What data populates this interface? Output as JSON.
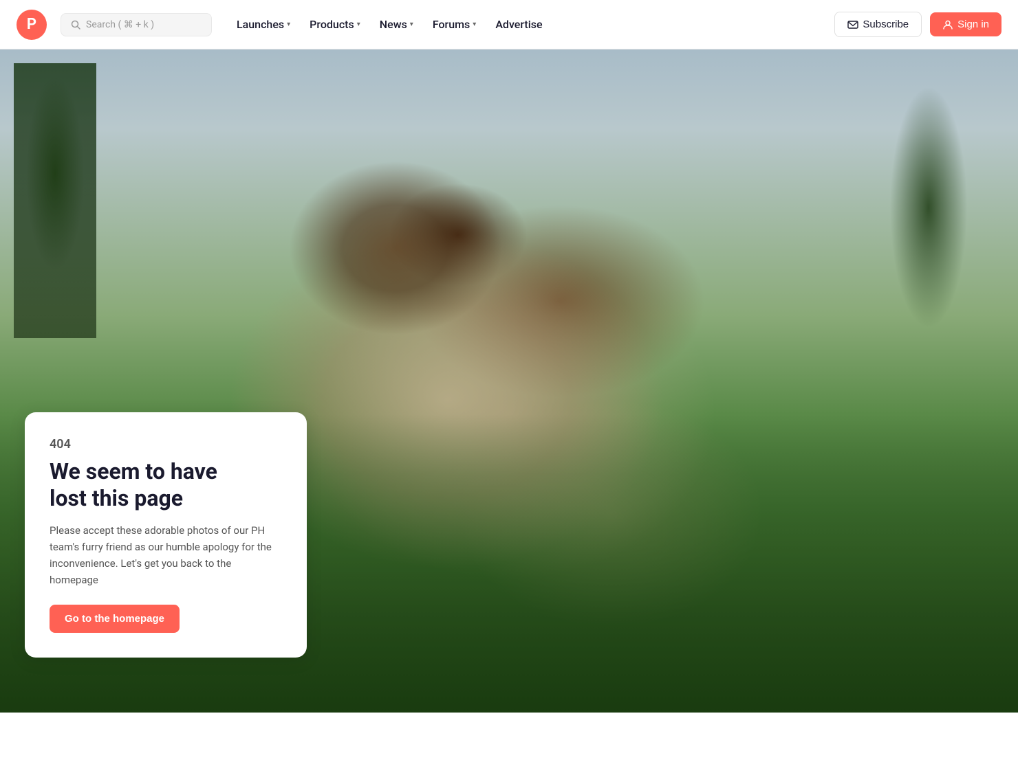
{
  "brand": {
    "logo_letter": "P",
    "logo_color": "#ff6154"
  },
  "search": {
    "placeholder": "Search ( ⌘ + k )"
  },
  "nav": {
    "items": [
      {
        "label": "Launches",
        "has_dropdown": true
      },
      {
        "label": "Products",
        "has_dropdown": true
      },
      {
        "label": "News",
        "has_dropdown": true
      },
      {
        "label": "Forums",
        "has_dropdown": true
      },
      {
        "label": "Advertise",
        "has_dropdown": false
      }
    ],
    "subscribe_label": "Subscribe",
    "signin_label": "Sign in"
  },
  "error": {
    "code": "404",
    "title_line1": "We seem to have",
    "title_line2": "lost this page",
    "description": "Please accept these adorable photos of our PH team's furry friend as our humble apology for the inconvenience. Let's get you back to the homepage",
    "cta_label": "Go to the homepage"
  }
}
